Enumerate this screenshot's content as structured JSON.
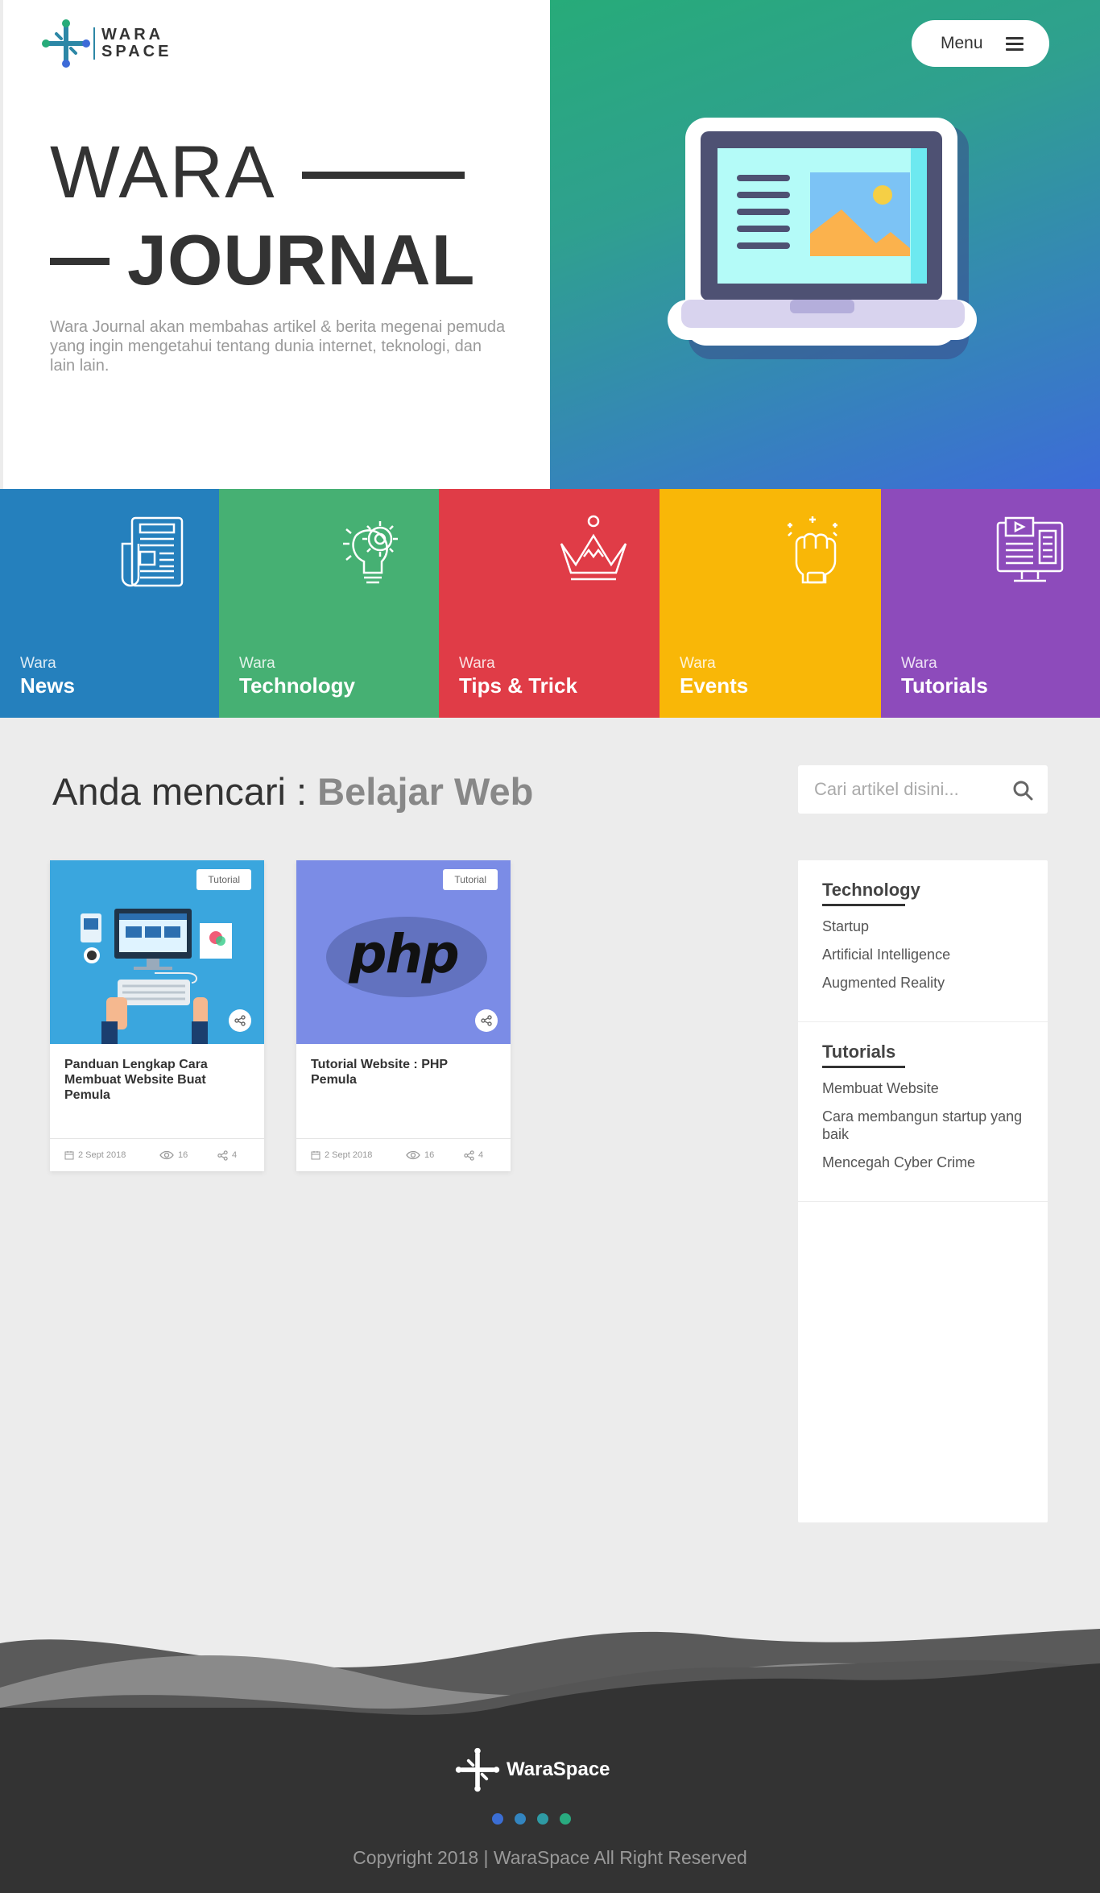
{
  "header": {
    "logo_line1": "WARA",
    "logo_line2": "SPACE",
    "menu_label": "Menu"
  },
  "hero": {
    "title_line1": "WARA",
    "title_line2": "JOURNAL",
    "description": "Wara Journal akan membahas artikel & berita megenai pemuda yang ingin mengetahui tentang dunia internet, teknologi, dan lain lain."
  },
  "categories": [
    {
      "small": "Wara",
      "big": "News",
      "color": "#2580bd",
      "icon": "newspaper-icon"
    },
    {
      "small": "Wara",
      "big": "Technology",
      "color": "#46b073",
      "icon": "idea-gear-icon"
    },
    {
      "small": "Wara",
      "big": "Tips & Trick",
      "color": "#e03c47",
      "icon": "crown-icon"
    },
    {
      "small": "Wara",
      "big": "Events",
      "color": "#f9b707",
      "icon": "fist-icon"
    },
    {
      "small": "Wara",
      "big": "Tutorials",
      "color": "#8d4bbb",
      "icon": "monitor-icon"
    }
  ],
  "search": {
    "heading_prefix": "Anda mencari : ",
    "heading_term": "Belajar Web",
    "placeholder": "Cari artikel disini..."
  },
  "articles": [
    {
      "tag": "Tutorial",
      "title": "Panduan Lengkap Cara Membuat Website Buat Pemula",
      "date": "2 Sept 2018",
      "views": "16",
      "shares": "4"
    },
    {
      "tag": "Tutorial",
      "title": "Tutorial Website : PHP Pemula",
      "date": "2 Sept 2018",
      "views": "16",
      "shares": "4",
      "image_text": "php"
    }
  ],
  "sidebar": {
    "sections": [
      {
        "heading": "Technology",
        "links": [
          "Startup",
          "Artificial Intelligence",
          "Augmented Reality"
        ]
      },
      {
        "heading": "Tutorials",
        "links": [
          "Membuat Website",
          "Cara membangun startup yang baik",
          "Mencegah Cyber Crime"
        ]
      }
    ]
  },
  "footer": {
    "brand": "WaraSpace",
    "copyright": "Copyright 2018 | WaraSpace All Right Reserved",
    "dot_colors": [
      "#3b6ed4",
      "#3385c0",
      "#2e9aa4",
      "#29ab80"
    ]
  }
}
